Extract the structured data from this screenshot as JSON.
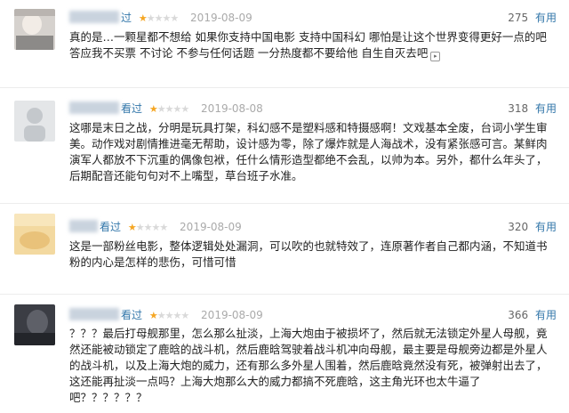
{
  "reviews": [
    {
      "name_suffix": "过",
      "rating": 1,
      "date": "2019-08-09",
      "useful_count": "275",
      "useful_label": "有用",
      "content": "真的是…一颗星都不想给 如果你支持中国电影 支持中国科幻 哪怕是让这个世界变得更好一点的吧 答应我不买票 不讨论 不参与任何话题 一分热度都不要给他 自生自灭去吧"
    },
    {
      "name_suffix": "看过",
      "rating": 1,
      "date": "2019-08-08",
      "useful_count": "318",
      "useful_label": "有用",
      "content": "这哪是末日之战，分明是玩具打架，科幻感不是塑料感和特摄感啊！文戏基本全废，台词小学生审美。动作戏对剧情推进毫无帮助，设计感为零，除了爆炸就是人海战术，没有紧张感可言。某鲜肉演军人都放不下沉重的偶像包袱，任什么情形造型都绝不会乱，以帅为本。另外，都什么年头了，后期配音还能句句对不上嘴型，草台班子水准。"
    },
    {
      "name_suffix": "看过",
      "rating": 1,
      "date": "2019-08-09",
      "useful_count": "320",
      "useful_label": "有用",
      "content": "这是一部粉丝电影，整体逻辑处处漏洞，可以吹的也就特效了，连原著作者自己都内涵，不知道书粉的内心是怎样的悲伤，可惜可惜"
    },
    {
      "name_suffix": "看过",
      "rating": 1,
      "date": "2019-08-09",
      "useful_count": "366",
      "useful_label": "有用",
      "content": "？？？最后打母舰那里，怎么那么扯淡，上海大炮由于被损坏了，然后就无法锁定外星人母舰，竟然还能被动锁定了鹿晗的战斗机，然后鹿晗驾驶着战斗机冲向母舰，最主要是母舰旁边都是外星人的战斗机，以及上海大炮的威力，还有那么多外星人围着，然后鹿晗竟然没有死，被弹射出去了，这还能再扯淡一点吗？上海大炮那么大的威力都搞不死鹿晗，这主角光环也太牛逼了吧？？？？？？"
    }
  ],
  "colors": {
    "link": "#3377aa",
    "star_on": "#f5a623",
    "star_off": "#d9d9d9",
    "date": "#aaaaaa"
  },
  "icons": [
    "avatar",
    "star-icon",
    "expand-icon"
  ]
}
